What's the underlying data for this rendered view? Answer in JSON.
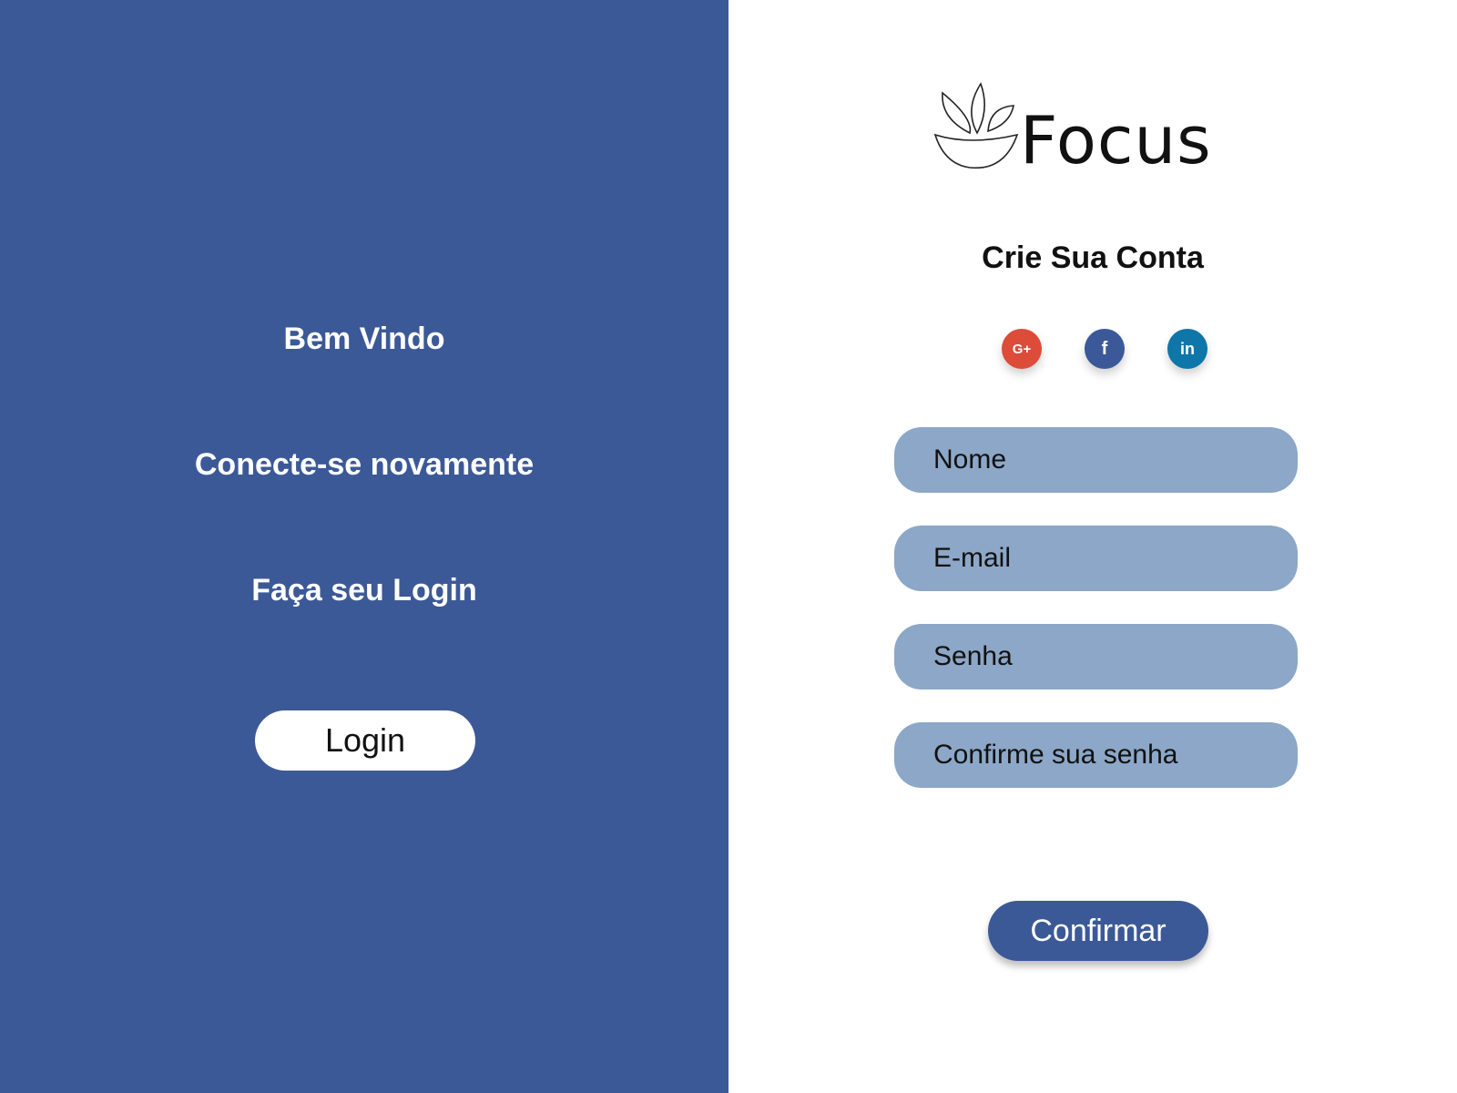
{
  "left_panel": {
    "welcome": "Bem Vindo",
    "reconnect": "Conecte-se novamente",
    "login_prompt": "Faça seu Login",
    "login_button": "Login",
    "background_color": "#3c5997"
  },
  "logo": {
    "text": "Focus",
    "icon": "lotus-bowl-icon"
  },
  "form": {
    "title": "Crie Sua Conta",
    "social": [
      {
        "label": "G+",
        "icon": "google-plus-icon",
        "color": "#dd4b39"
      },
      {
        "label": "f",
        "icon": "facebook-icon",
        "color": "#3b5998"
      },
      {
        "label": "in",
        "icon": "linkedin-icon",
        "color": "#0e76a8"
      }
    ],
    "fields": {
      "name_placeholder": "Nome",
      "email_placeholder": "E-mail",
      "password_placeholder": "Senha",
      "confirm_placeholder": "Confirme sua senha"
    },
    "confirm_button": "Confirmar",
    "field_color": "#8ca7c7"
  }
}
